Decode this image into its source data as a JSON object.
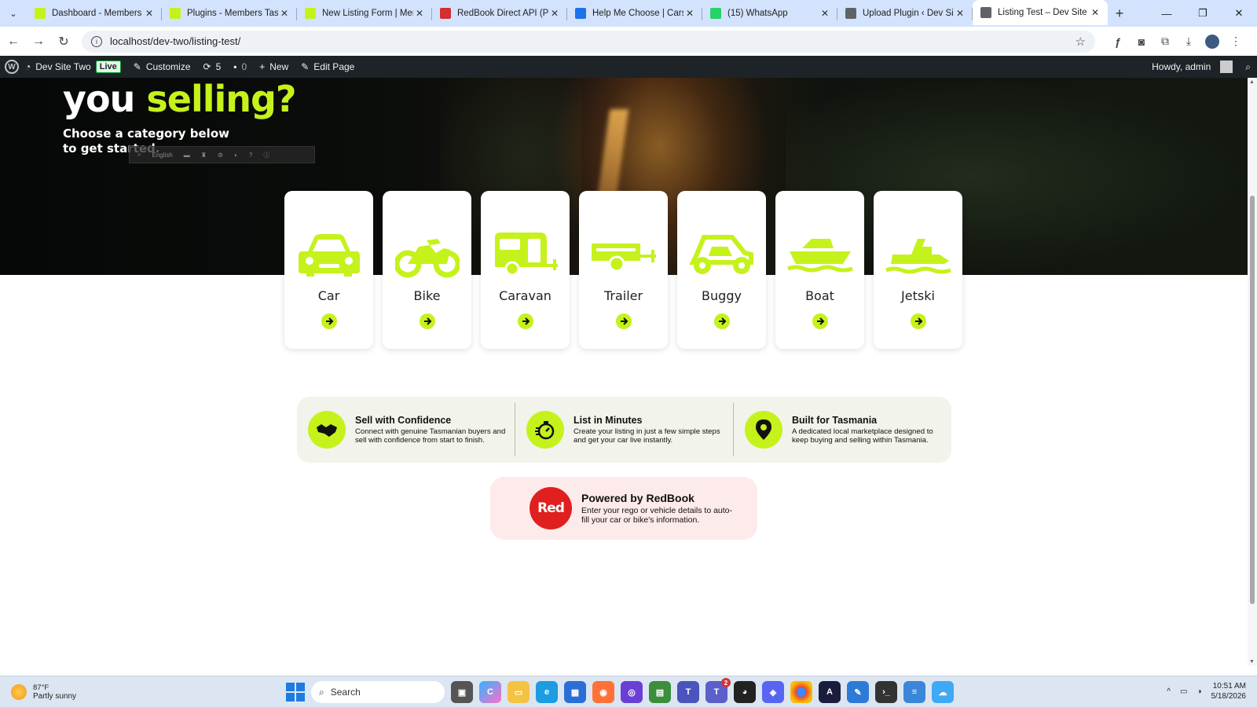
{
  "browser": {
    "tabs": [
      {
        "title": "Dashboard - Members Ta",
        "icon": "members-favicon",
        "color": "#c5f21b"
      },
      {
        "title": "Plugins - Members Tasma",
        "icon": "members-favicon",
        "color": "#c5f21b"
      },
      {
        "title": "New Listing Form | Memb",
        "icon": "members-favicon",
        "color": "#c5f21b"
      },
      {
        "title": "RedBook Direct API (Prod",
        "icon": "redbook-favicon",
        "color": "#d32f2f"
      },
      {
        "title": "Help Me Choose | Carsale",
        "icon": "carsales-favicon",
        "color": "#1a73e8"
      },
      {
        "title": "(15) WhatsApp",
        "icon": "whatsapp-favicon",
        "color": "#25d366"
      },
      {
        "title": "Upload Plugin ‹ Dev Site T",
        "icon": "globe-favicon",
        "color": "#5f6368"
      },
      {
        "title": "Listing Test – Dev Site Tw",
        "icon": "globe-favicon",
        "color": "#5f6368"
      }
    ],
    "url": "localhost/dev-two/listing-test/"
  },
  "wpbar": {
    "site_name": "Dev Site Two",
    "live": "Live",
    "customize": "Customize",
    "updates": "5",
    "comments": "0",
    "new": "New",
    "edit": "Edit Page",
    "howdy": "Howdy, admin"
  },
  "hero": {
    "title_part1": "you ",
    "title_accent": "selling?",
    "subtitle": "Choose a category below to get started.",
    "translate_lang": "English"
  },
  "categories": [
    {
      "label": "Car",
      "icon": "car-icon"
    },
    {
      "label": "Bike",
      "icon": "motorbike-icon"
    },
    {
      "label": "Caravan",
      "icon": "caravan-icon"
    },
    {
      "label": "Trailer",
      "icon": "trailer-icon"
    },
    {
      "label": "Buggy",
      "icon": "buggy-icon"
    },
    {
      "label": "Boat",
      "icon": "boat-icon"
    },
    {
      "label": "Jetski",
      "icon": "jetski-icon"
    }
  ],
  "features": [
    {
      "title": "Sell with Confidence",
      "desc": "Connect with genuine Tasmanian buyers and sell with confidence from start to finish.",
      "icon": "handshake-icon"
    },
    {
      "title": "List in Minutes",
      "desc": "Create your listing in just a few simple steps and get your car live instantly.",
      "icon": "stopwatch-icon"
    },
    {
      "title": "Built for Tasmania",
      "desc": "A dedicated local marketplace designed to keep buying and selling within Tasmania.",
      "icon": "map-pin-icon"
    }
  ],
  "powered": {
    "title": "Powered by RedBook",
    "desc": "Enter your rego or vehicle details to auto-fill your car or bike's information.",
    "logo_text": "Red"
  },
  "taskbar": {
    "temp": "87°F",
    "weather": "Partly sunny",
    "search": "Search",
    "time": "10:51 AM",
    "date": "5/18/2026",
    "badge_teams": "2"
  },
  "colors": {
    "accent": "#c5f21b",
    "brand_red": "#e01f1f"
  }
}
